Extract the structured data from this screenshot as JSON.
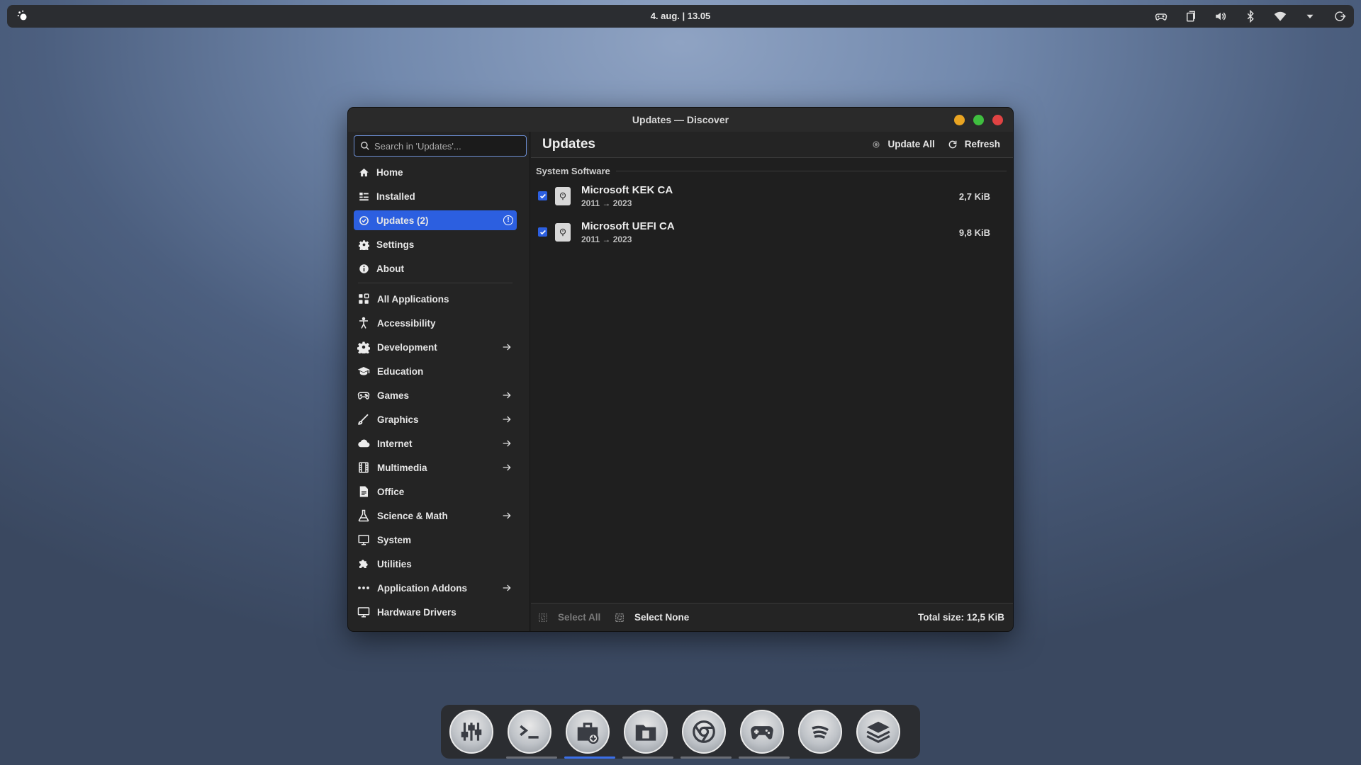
{
  "panel": {
    "clock": "4. aug. | 13.05",
    "tray_icons": [
      "gamepad-icon",
      "clipboard-icon",
      "volume-icon",
      "bluetooth-icon",
      "wifi-icon",
      "chevron-down-icon",
      "power-icon"
    ]
  },
  "window": {
    "title": "Updates — Discover",
    "search_placeholder": "Search in 'Updates'...",
    "nav": [
      {
        "label": "Home",
        "icon": "home-icon"
      },
      {
        "label": "Installed",
        "icon": "installed-icon"
      },
      {
        "label": "Updates (2)",
        "icon": "updates-icon",
        "active": true,
        "alert": "!"
      },
      {
        "label": "Settings",
        "icon": "gear-icon"
      },
      {
        "label": "About",
        "icon": "info-icon"
      }
    ],
    "categories": [
      {
        "label": "All Applications",
        "icon": "grid-icon",
        "arrow": false
      },
      {
        "label": "Accessibility",
        "icon": "accessibility-icon",
        "arrow": false
      },
      {
        "label": "Development",
        "icon": "gear-icon",
        "arrow": true
      },
      {
        "label": "Education",
        "icon": "graduation-cap-icon",
        "arrow": false
      },
      {
        "label": "Games",
        "icon": "gamepad-icon",
        "arrow": true
      },
      {
        "label": "Graphics",
        "icon": "brush-icon",
        "arrow": true
      },
      {
        "label": "Internet",
        "icon": "cloud-icon",
        "arrow": true
      },
      {
        "label": "Multimedia",
        "icon": "film-icon",
        "arrow": true
      },
      {
        "label": "Office",
        "icon": "document-icon",
        "arrow": false
      },
      {
        "label": "Science & Math",
        "icon": "flask-icon",
        "arrow": true
      },
      {
        "label": "System",
        "icon": "monitor-icon",
        "arrow": false
      },
      {
        "label": "Utilities",
        "icon": "puzzle-icon",
        "arrow": false
      },
      {
        "label": "Application Addons",
        "icon": "dots-icon",
        "arrow": true
      },
      {
        "label": "Hardware Drivers",
        "icon": "display-icon",
        "arrow": false
      }
    ],
    "main": {
      "title": "Updates",
      "update_all_label": "Update All",
      "refresh_label": "Refresh",
      "section_label": "System Software",
      "updates": [
        {
          "name": "Microsoft KEK CA",
          "version": "2011 → 2023",
          "size": "2,7 KiB",
          "checked": true
        },
        {
          "name": "Microsoft UEFI CA",
          "version": "2011 → 2023",
          "size": "9,8 KiB",
          "checked": true
        }
      ],
      "footer": {
        "select_all": "Select All",
        "select_none": "Select None",
        "total": "Total size: 12,5 KiB"
      }
    }
  },
  "dock": {
    "items": [
      {
        "name": "mixer-icon",
        "running": false
      },
      {
        "name": "terminal-icon",
        "running": true
      },
      {
        "name": "discover-icon",
        "running": true,
        "active": true
      },
      {
        "name": "files-icon",
        "running": true
      },
      {
        "name": "chrome-icon",
        "running": true
      },
      {
        "name": "gamepad-icon",
        "running": true
      },
      {
        "name": "spotify-icon",
        "running": false
      },
      {
        "name": "layers-icon",
        "running": false
      }
    ]
  }
}
